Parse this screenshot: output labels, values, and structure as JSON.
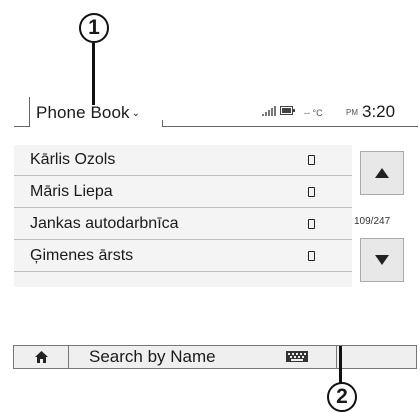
{
  "callouts": {
    "one": "1",
    "two": "2"
  },
  "header": {
    "tab_label": "Phone Book",
    "chevron": "⌄",
    "temperature": "-- °C",
    "ampm": "PM",
    "time": "3:20"
  },
  "contacts": [
    {
      "name": "Kārlis Ozols",
      "icon": "phone-icon"
    },
    {
      "name": "Māris Liepa",
      "icon": "phone-icon"
    },
    {
      "name": "Jankas autodarbnīca",
      "icon": "phone-icon"
    },
    {
      "name": "Ģimenes ārsts",
      "icon": "phone-icon"
    }
  ],
  "scroll": {
    "page_count": "109/247"
  },
  "bottom_bar": {
    "search_label": "Search by Name"
  },
  "icons": [
    "signal-icon",
    "battery-icon",
    "home-icon",
    "keyboard-icon",
    "scroll-up-icon",
    "scroll-down-icon"
  ]
}
